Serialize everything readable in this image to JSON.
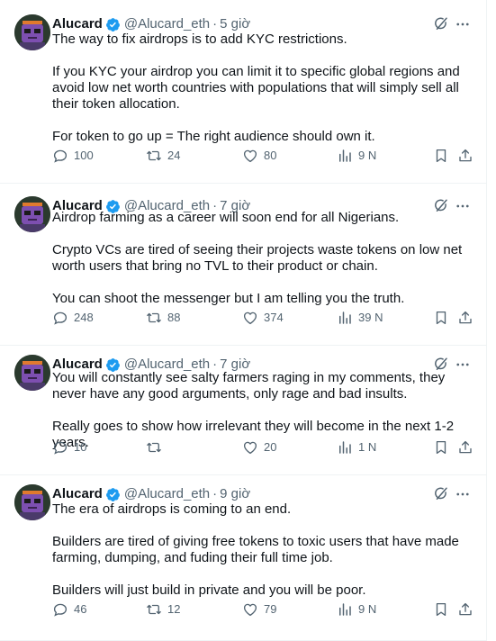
{
  "tweets": [
    {
      "name": "Alucard",
      "handle": "@Alucard_eth",
      "time": "5 giờ",
      "text": "The way to fix airdrops is to add KYC restrictions.\n\nIf you KYC your airdrop you can limit it to specific global regions and avoid low net worth countries with populations that will simply sell all their token allocation.\n\nFor token to go up = The right audience should own it.",
      "replies": "100",
      "retweets": "24",
      "likes": "80",
      "views": "9 N"
    },
    {
      "name": "Alucard",
      "handle": "@Alucard_eth",
      "time": "7 giờ",
      "text": "Airdrop farming as a career will soon end for all Nigerians.\n\nCrypto VCs are tired of seeing their projects waste tokens on low net worth users that bring no TVL to their product or chain.\n\nYou can shoot the messenger but I am telling you the truth.",
      "replies": "248",
      "retweets": "88",
      "likes": "374",
      "views": "39 N"
    },
    {
      "name": "Alucard",
      "handle": "@Alucard_eth",
      "time": "7 giờ",
      "text": "You will constantly see salty farmers raging in my comments, they never have any good arguments, only rage and bad insults.\n\nReally goes to show how irrelevant they will become in the next 1-2 years.",
      "replies": "10",
      "retweets": "",
      "likes": "20",
      "views": "1 N"
    },
    {
      "name": "Alucard",
      "handle": "@Alucard_eth",
      "time": "9 giờ",
      "text": "The era of airdrops is coming to an end.\n\nBuilders are tired of giving free tokens to toxic users that have made farming, dumping, and fuding their full time job.\n\nBuilders will just build in private and you will be poor.",
      "replies": "46",
      "retweets": "12",
      "likes": "79",
      "views": "9 N"
    }
  ],
  "colors": {
    "verified": "#1d9bf0",
    "secondary": "#536471",
    "avatar_bg": "#2b3a2e",
    "avatar_face": "#7d4fb0"
  },
  "icons": [
    "verified-badge-icon",
    "grok-icon",
    "more-icon",
    "reply-icon",
    "retweet-icon",
    "like-icon",
    "views-icon",
    "bookmark-icon",
    "share-icon"
  ]
}
